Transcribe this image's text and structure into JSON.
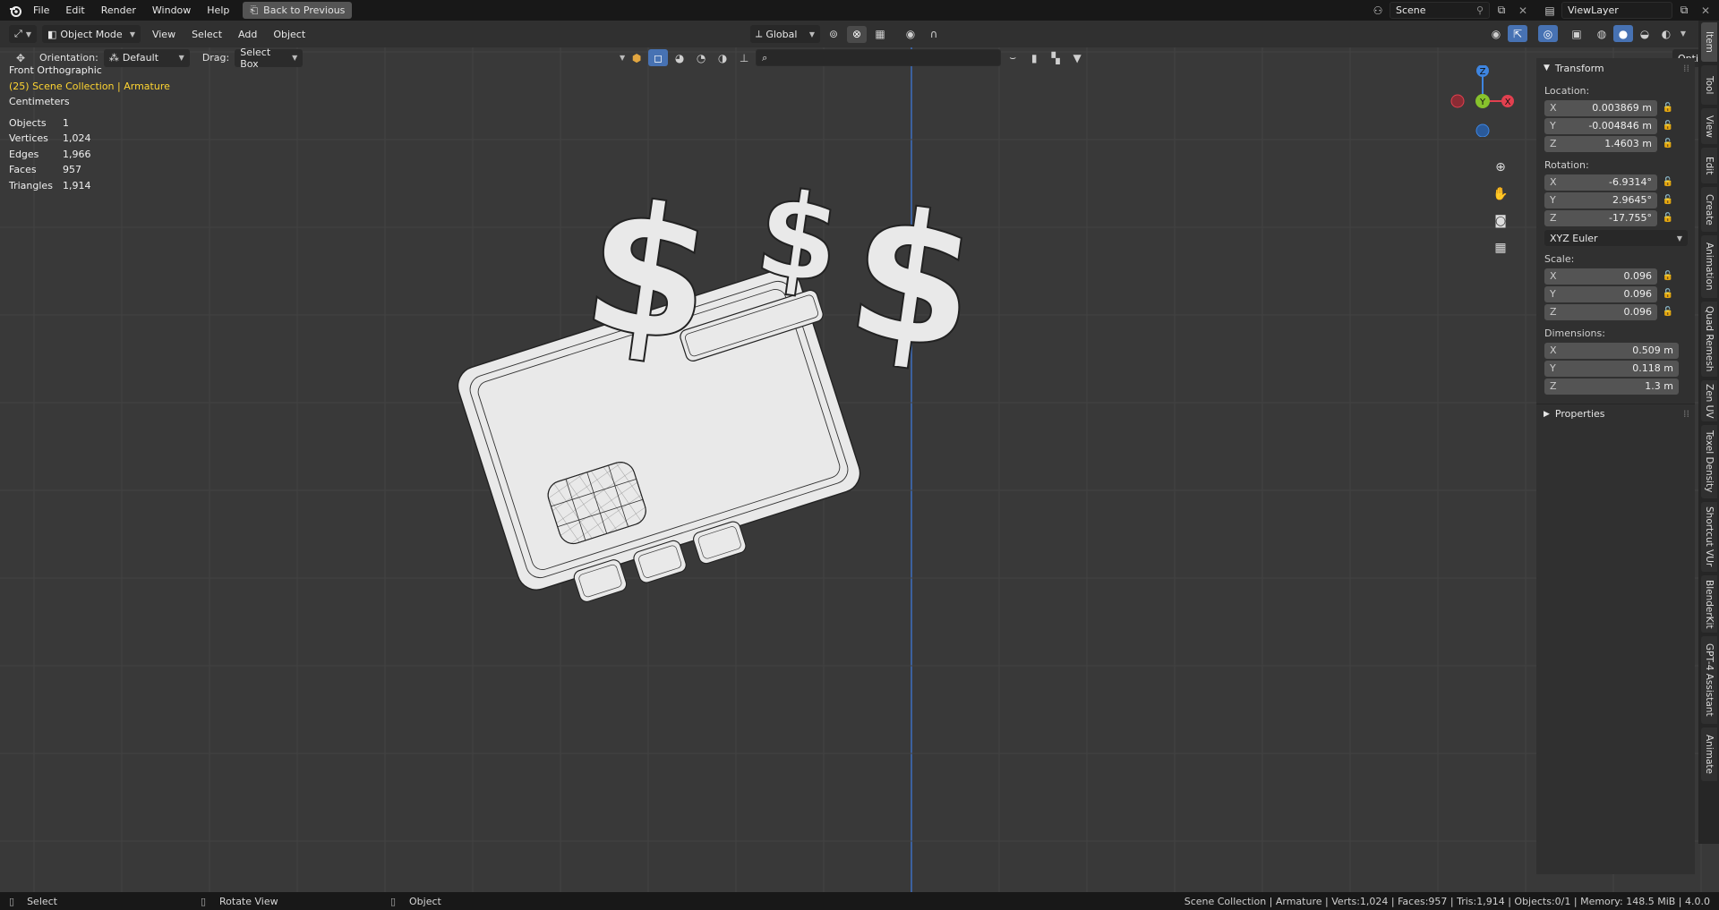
{
  "topbar": {
    "menus": [
      "File",
      "Edit",
      "Render",
      "Window",
      "Help"
    ],
    "back_button": "Back to Previous",
    "scene": "Scene",
    "view_layer": "ViewLayer"
  },
  "header": {
    "mode": "Object Mode",
    "menus": [
      "View",
      "Select",
      "Add",
      "Object"
    ],
    "transform_orientation": "Global"
  },
  "tool_header": {
    "orientation_label": "Orientation:",
    "orientation_value": "Default",
    "drag_label": "Drag:",
    "drag_value": "Select Box",
    "options": "Options"
  },
  "overlay": {
    "view_name": "Front Orthographic",
    "collection": "(25) Scene Collection | Armature",
    "units": "Centimeters",
    "stats": [
      {
        "label": "Objects",
        "value": "1"
      },
      {
        "label": "Vertices",
        "value": "1,024"
      },
      {
        "label": "Edges",
        "value": "1,966"
      },
      {
        "label": "Faces",
        "value": "957"
      },
      {
        "label": "Triangles",
        "value": "1,914"
      }
    ]
  },
  "gizmo": {
    "z": "Z",
    "y": "Y",
    "x": "X"
  },
  "npanel": {
    "title": "Transform",
    "location_label": "Location:",
    "location": [
      {
        "axis": "X",
        "value": "0.003869 m"
      },
      {
        "axis": "Y",
        "value": "-0.004846 m"
      },
      {
        "axis": "Z",
        "value": "1.4603 m"
      }
    ],
    "rotation_label": "Rotation:",
    "rotation": [
      {
        "axis": "X",
        "value": "-6.9314°"
      },
      {
        "axis": "Y",
        "value": "2.9645°"
      },
      {
        "axis": "Z",
        "value": "-17.755°"
      }
    ],
    "rotation_mode": "XYZ Euler",
    "scale_label": "Scale:",
    "scale": [
      {
        "axis": "X",
        "value": "0.096"
      },
      {
        "axis": "Y",
        "value": "0.096"
      },
      {
        "axis": "Z",
        "value": "0.096"
      }
    ],
    "dimensions_label": "Dimensions:",
    "dimensions": [
      {
        "axis": "X",
        "value": "0.509 m"
      },
      {
        "axis": "Y",
        "value": "0.118 m"
      },
      {
        "axis": "Z",
        "value": "1.3 m"
      }
    ],
    "properties": "Properties"
  },
  "side_tabs": [
    "Item",
    "Tool",
    "View",
    "Edit",
    "Create",
    "Animation",
    "Quad Remesh",
    "Zen UV",
    "Texel Density",
    "Shortcut VUr",
    "BlenderKit",
    "GPT-4 Assistant",
    "Animate"
  ],
  "statusbar": {
    "select": "Select",
    "rotate": "Rotate View",
    "object": "Object",
    "info": "Scene Collection | Armature | Verts:1,024 | Faces:957 | Tris:1,914 | Objects:0/1 | Memory: 148.5 MiB | 4.0.0"
  },
  "colors": {
    "accent": "#4772b3",
    "x_axis": "#e2404f",
    "y_axis": "#87c22c",
    "z_axis": "#3e85e0",
    "collection_text": "#ffd531"
  }
}
